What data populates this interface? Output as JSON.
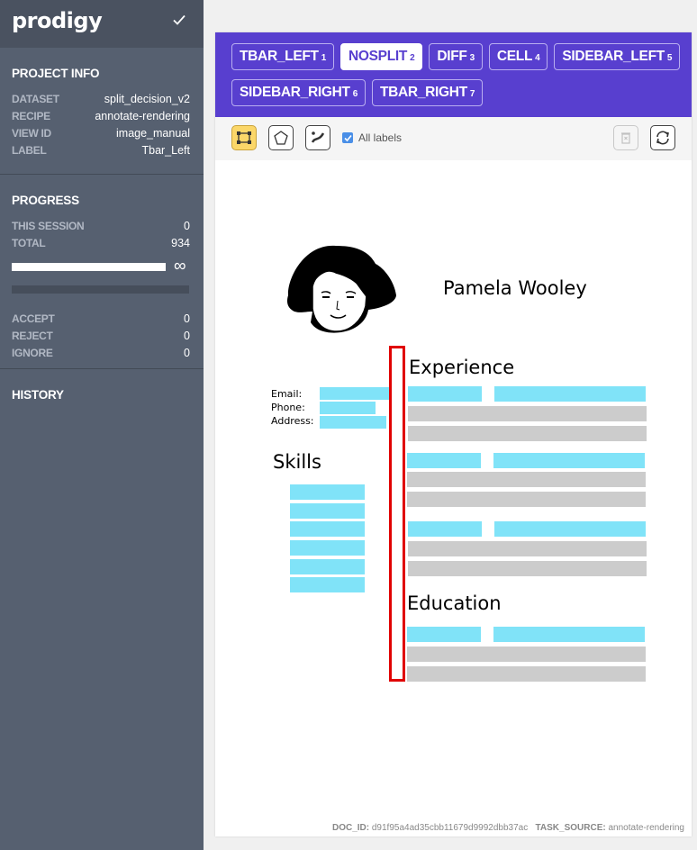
{
  "app": {
    "logo": "prodigy"
  },
  "project_info": {
    "title": "PROJECT INFO",
    "rows": [
      {
        "key": "DATASET",
        "value": "split_decision_v2"
      },
      {
        "key": "RECIPE",
        "value": "annotate-rendering"
      },
      {
        "key": "VIEW ID",
        "value": "image_manual"
      },
      {
        "key": "LABEL",
        "value": "Tbar_Left"
      }
    ]
  },
  "progress": {
    "title": "PROGRESS",
    "rows": [
      {
        "key": "THIS SESSION",
        "value": "0"
      },
      {
        "key": "TOTAL",
        "value": "934"
      }
    ],
    "infinity": "∞",
    "fraction": 1.0,
    "decisions": [
      {
        "key": "ACCEPT",
        "value": "0"
      },
      {
        "key": "REJECT",
        "value": "0"
      },
      {
        "key": "IGNORE",
        "value": "0"
      }
    ]
  },
  "history": {
    "title": "HISTORY"
  },
  "labels": [
    {
      "name": "TBAR_LEFT",
      "num": "1",
      "selected": false
    },
    {
      "name": "NOSPLIT",
      "num": "2",
      "selected": true
    },
    {
      "name": "DIFF",
      "num": "3",
      "selected": false
    },
    {
      "name": "CELL",
      "num": "4",
      "selected": false
    },
    {
      "name": "SIDEBAR_LEFT",
      "num": "5",
      "selected": false
    },
    {
      "name": "SIDEBAR_RIGHT",
      "num": "6",
      "selected": false
    },
    {
      "name": "TBAR_RIGHT",
      "num": "7",
      "selected": false
    }
  ],
  "toolbar": {
    "all_labels": "All labels",
    "tools": [
      "rectangle-tool-icon",
      "polygon-tool-icon",
      "freehand-tool-icon"
    ],
    "actions": [
      "delete-icon",
      "reset-icon"
    ]
  },
  "resume": {
    "name": "Pamela Wooley",
    "experience_heading": "Experience",
    "education_heading": "Education",
    "skills_heading": "Skills",
    "contact_labels": [
      "Email:",
      "Phone:",
      "Address:"
    ]
  },
  "meta": {
    "doc_id_label": "DOC_ID:",
    "doc_id": "d91f95a4ad35cbb11679d9992dbb37ac",
    "task_source_label": "TASK_SOURCE:",
    "task_source": "annotate-rendering"
  },
  "colors": {
    "accent": "#583fcf",
    "sidebar": "#566070",
    "placeholder_blue": "#80e3f8",
    "placeholder_gray": "#cccccc",
    "annotation_red": "#e00000",
    "active_tool": "#fbd769"
  }
}
